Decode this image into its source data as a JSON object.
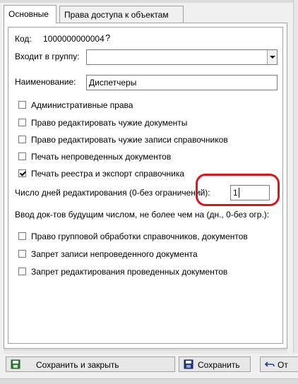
{
  "tabs": [
    {
      "label": "Основные",
      "active": true
    },
    {
      "label": "Права доступа к объектам",
      "active": false
    }
  ],
  "form": {
    "code_label": "Код:",
    "code_value": "1000000000004",
    "group_label": "Входит в группу:",
    "group_value": "",
    "name_label": "Наименование:",
    "name_value": "Диспетчеры",
    "edit_days_label": "Число дней редактирования (0-без ограничений):",
    "edit_days_value": "1",
    "future_input_label": "Ввод док-тов будущим числом, не более чем на (дн., 0-без огр.):"
  },
  "checkboxes": [
    {
      "label": "Административные права",
      "checked": false
    },
    {
      "label": "Право редактировать чужие документы",
      "checked": false
    },
    {
      "label": "Право редактировать чужие записи справочников",
      "checked": false
    },
    {
      "label": "Печать непроведенных документов",
      "checked": false
    },
    {
      "label": "Печать реестра и экспорт справочника",
      "checked": true
    },
    {
      "label": "Право групповой обработки справочников, документов",
      "checked": false
    },
    {
      "label": "Запрет записи непроведенного документа",
      "checked": false
    },
    {
      "label": "Запрет редактирования проведенных документов",
      "checked": false
    }
  ],
  "buttons": {
    "save_close": "Сохранить и закрыть",
    "save": "Сохранить",
    "cancel": "От"
  },
  "colors": {
    "highlight_ring": "#e0141c"
  }
}
